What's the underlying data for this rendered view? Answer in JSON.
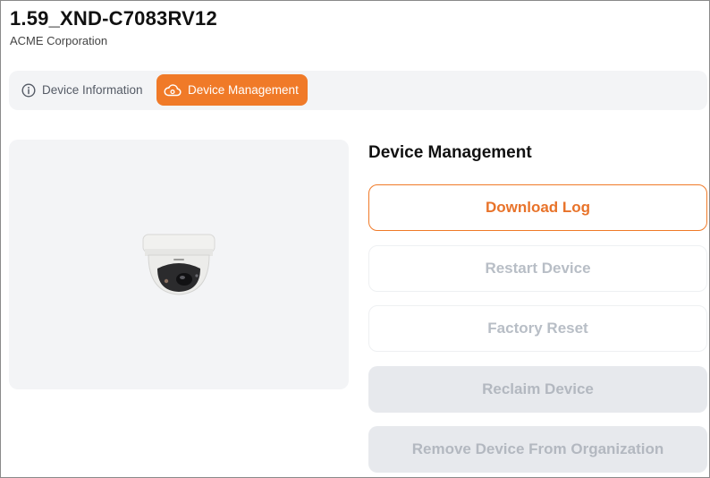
{
  "device": {
    "name": "1.59_XND-C7083RV12",
    "organization": "ACME Corporation"
  },
  "tabs": [
    {
      "label": "Device Information",
      "icon": "info-circle-icon",
      "active": false
    },
    {
      "label": "Device Management",
      "icon": "cloud-settings-icon",
      "active": true
    }
  ],
  "image": {
    "icon": "dome-camera-image"
  },
  "management": {
    "title": "Device Management",
    "buttons": {
      "download_log": "Download Log",
      "restart_device": "Restart Device",
      "factory_reset": "Factory Reset",
      "reclaim_device": "Reclaim Device",
      "remove_device": "Remove Device From Organization"
    }
  },
  "colors": {
    "accent": "#f07a28",
    "disabled_text": "#b8bec6",
    "panel_bg": "#f3f4f6"
  }
}
